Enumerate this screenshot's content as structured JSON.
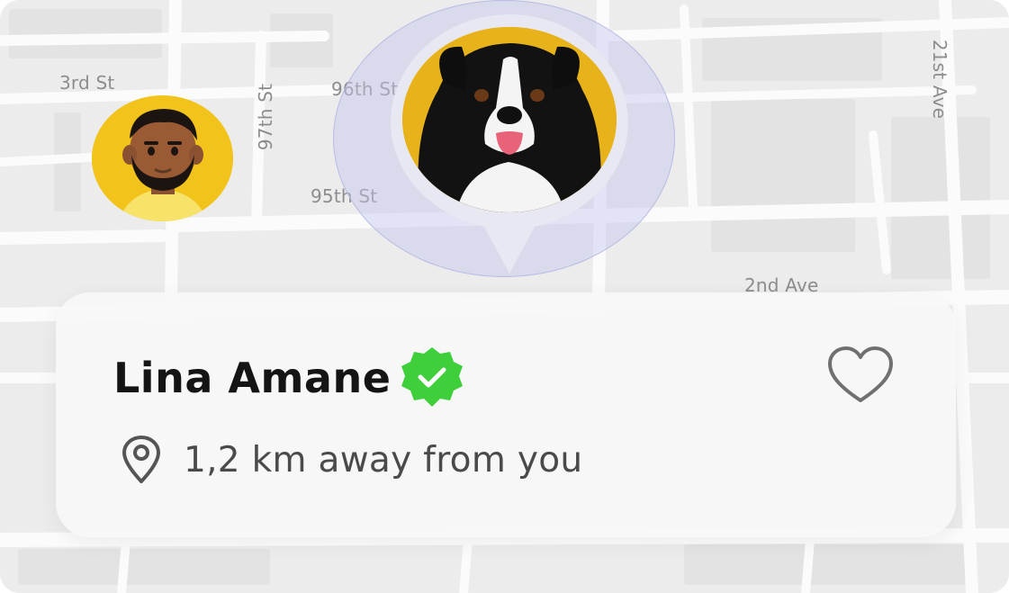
{
  "map": {
    "streets": {
      "third": "3rd St",
      "ninety_sixth": "96th St",
      "ninety_fifth": "95th St",
      "ninety_seventh": "97th St",
      "twenty_first": "21st Ave",
      "second_ave": "2nd Ave"
    }
  },
  "markers": {
    "user_icon": "user-avatar",
    "pet_icon": "dog-photo"
  },
  "card": {
    "name": "Lina Amane",
    "verified_icon": "verified-badge-icon",
    "distance": "1,2 km away from you",
    "favorite_icon": "heart-icon",
    "location_icon": "location-pin-icon"
  },
  "colors": {
    "accent_yellow": "#f2c31a",
    "verified_green": "#3fcf3a",
    "pulse_ring": "#c4c6ec",
    "map_background": "#ececec"
  }
}
